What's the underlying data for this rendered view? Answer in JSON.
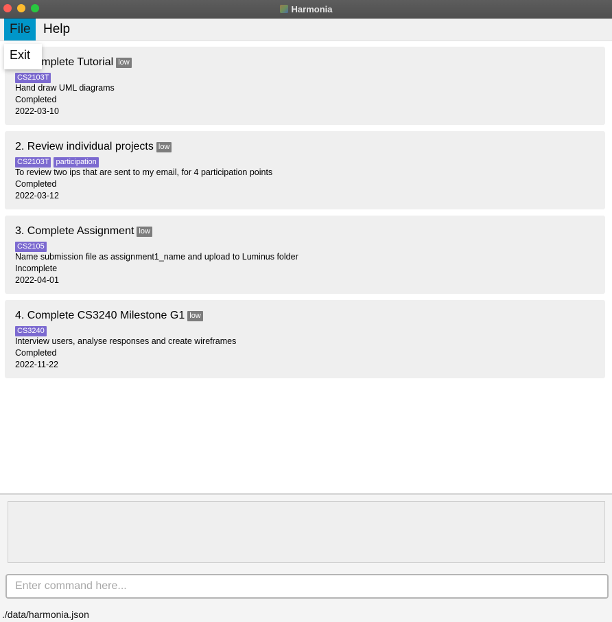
{
  "window": {
    "title": "Harmonia"
  },
  "menu": {
    "file_label": "File",
    "help_label": "Help",
    "file_dropdown": {
      "exit_label": "Exit"
    }
  },
  "tasks": [
    {
      "title": "1. Complete Tutorial",
      "priority": "low",
      "tags": [
        "CS2103T"
      ],
      "description": "Hand draw UML diagrams",
      "status": "Completed",
      "date": "2022-03-10"
    },
    {
      "title": "2. Review individual projects",
      "priority": "low",
      "tags": [
        "CS2103T",
        "participation"
      ],
      "description": "To review two ips that are sent to my email, for 4 participation points",
      "status": "Completed",
      "date": "2022-03-12"
    },
    {
      "title": "3. Complete Assignment",
      "priority": "low",
      "tags": [
        "CS2105"
      ],
      "description": "Name submission file as assignment1_name and upload to Luminus folder",
      "status": "Incomplete",
      "date": "2022-04-01"
    },
    {
      "title": "4. Complete CS3240 Milestone G1",
      "priority": "low",
      "tags": [
        "CS3240"
      ],
      "description": "Interview users, analyse responses and create wireframes",
      "status": "Completed",
      "date": "2022-11-22"
    }
  ],
  "result_display": {
    "text": ""
  },
  "command_box": {
    "value": "",
    "placeholder": "Enter command here..."
  },
  "status_bar": {
    "file_path": "./data/harmonia.json"
  },
  "colors": {
    "menu_active": "#0096c9",
    "tag": "#7c6ad0",
    "priority_badge": "#7d7d7d",
    "card_background": "#efefef"
  }
}
